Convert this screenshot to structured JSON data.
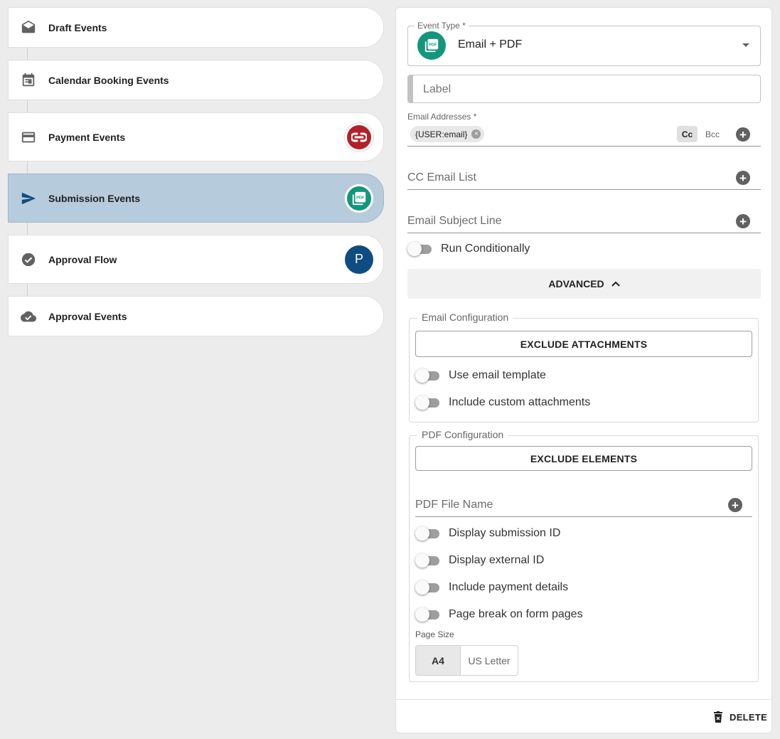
{
  "events": [
    {
      "label": "Draft Events",
      "icon": "envelope-open-icon",
      "badge": ""
    },
    {
      "label": "Calendar Booking Events",
      "icon": "calendar-icon",
      "badge": ""
    },
    {
      "label": "Payment Events",
      "icon": "credit-card-icon",
      "badge": ""
    },
    {
      "label": "Submission Events",
      "icon": "send-icon",
      "badge": "PDF"
    },
    {
      "label": "Approval Flow",
      "icon": "check-circle-icon",
      "badge": "P"
    },
    {
      "label": "Approval Events",
      "icon": "cloud-check-icon",
      "badge": ""
    }
  ],
  "form": {
    "event_type_label": "Event Type *",
    "event_type_value": "Email + PDF",
    "event_type_badge": "PDF",
    "label_placeholder": "Label",
    "email_addresses_label": "Email Addresses *",
    "email_chip": "{USER:email}",
    "cc_label": "Cc",
    "bcc_label": "Bcc",
    "cc_list_placeholder": "CC Email List",
    "subject_placeholder": "Email Subject Line",
    "run_conditionally": "Run Conditionally",
    "advanced_label": "ADVANCED",
    "email_config": {
      "legend": "Email Configuration",
      "exclude_attachments": "EXCLUDE ATTACHMENTS",
      "use_template": "Use email template",
      "custom_attachments": "Include custom attachments"
    },
    "pdf_config": {
      "legend": "PDF Configuration",
      "exclude_elements": "EXCLUDE ELEMENTS",
      "file_name_placeholder": "PDF File Name",
      "display_submission_id": "Display submission ID",
      "display_external_id": "Display external ID",
      "include_payment_details": "Include payment details",
      "page_break": "Page break on form pages",
      "page_size_label": "Page Size",
      "page_size_options": [
        "A4",
        "US Letter"
      ],
      "page_size_selected": "A4"
    },
    "delete_label": "DELETE"
  },
  "colors": {
    "active_bg": "#b6cbdc",
    "payment_badge": "#b32128",
    "pdf_badge": "#14967d",
    "approval_badge": "#0f4c81",
    "send_icon": "#0f4c81"
  }
}
